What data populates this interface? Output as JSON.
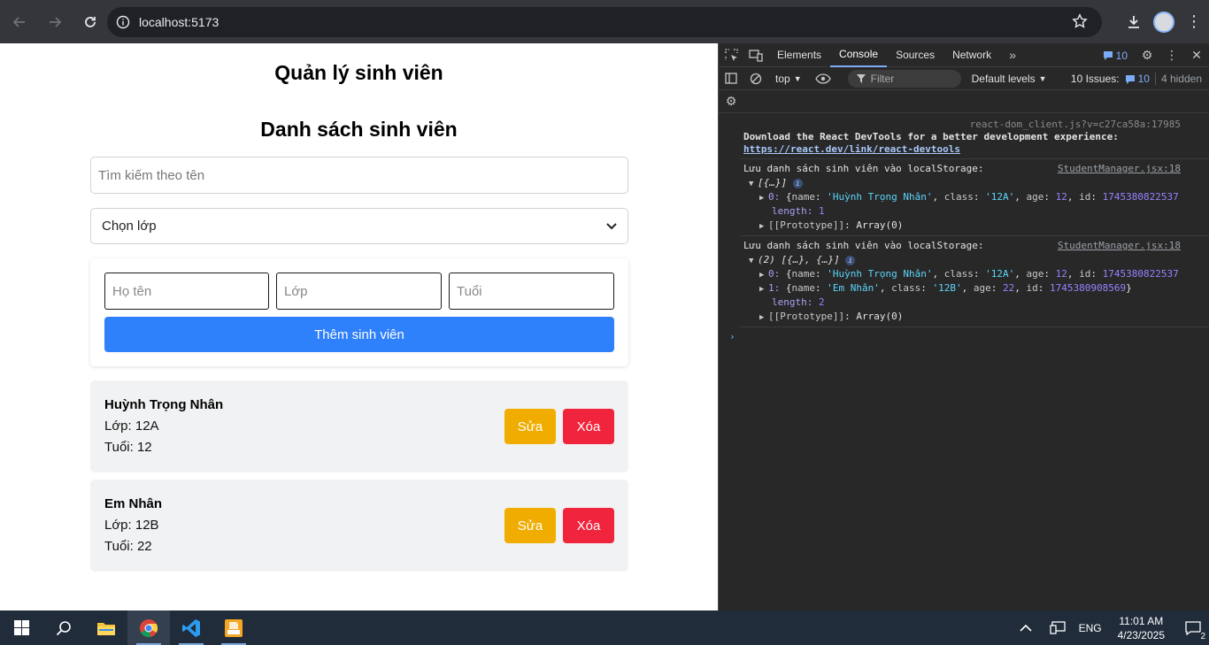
{
  "browser": {
    "url": "localhost:5173"
  },
  "page": {
    "title": "Quản lý sinh viên",
    "list_title": "Danh sách sinh viên",
    "search_placeholder": "Tìm kiếm theo tên",
    "class_select_value": "Chọn lớp",
    "form": {
      "name_placeholder": "Họ tên",
      "class_placeholder": "Lớp",
      "age_placeholder": "Tuổi",
      "add_label": "Thêm sinh viên"
    },
    "students": [
      {
        "name": "Huỳnh Trọng Nhân",
        "class_line": "Lớp: 12A",
        "age_line": "Tuổi: 12",
        "edit_label": "Sửa",
        "delete_label": "Xóa"
      },
      {
        "name": "Em Nhân",
        "class_line": "Lớp: 12B",
        "age_line": "Tuổi: 22",
        "edit_label": "Sửa",
        "delete_label": "Xóa"
      }
    ]
  },
  "devtools": {
    "tabs": [
      "Elements",
      "Console",
      "Sources",
      "Network"
    ],
    "active_tab": "Console",
    "message_count": "10",
    "context": "top",
    "filter_placeholder": "Filter",
    "levels": "Default levels",
    "issues_label": "10 Issues:",
    "issues_count": "10",
    "hidden": "4 hidden",
    "console": {
      "react_source": "react-dom_client.js?v=c27ca58a:17985",
      "react_msg": "Download the React DevTools for a better development experience:",
      "react_link": "https://react.dev/link/react-devtools",
      "log1_msg": "Lưu danh sách sinh viên vào localStorage:",
      "log1_src": "StudentManager.jsx:18",
      "log1_summary": "[{…}]",
      "log1_item0_key": "0:",
      "log1_item0_name": "'Huỳnh Trọng Nhân'",
      "log1_item0_class": "'12A'",
      "log1_item0_age": "12",
      "log1_item0_id": "1745380822537",
      "log1_length": "1",
      "log2_msg": "Lưu danh sách sinh viên vào localStorage:",
      "log2_src": "StudentManager.jsx:18",
      "log2_summary": "(2) [{…}, {…}]",
      "log2_item0_key": "0:",
      "log2_item0_name": "'Huỳnh Trọng Nhân'",
      "log2_item0_class": "'12A'",
      "log2_item0_age": "12",
      "log2_item0_id": "1745380822537",
      "log2_item1_key": "1:",
      "log2_item1_name": "'Em Nhân'",
      "log2_item1_class": "'12B'",
      "log2_item1_age": "22",
      "log2_item1_id": "1745380908569",
      "log2_length": "2",
      "proto": "[[Prototype]]",
      "proto_val": "Array(0)",
      "length_key": "length:"
    }
  },
  "taskbar": {
    "language": "ENG",
    "time": "11:01 AM",
    "date": "4/23/2025",
    "notification_count": "2"
  },
  "colors": {
    "primary": "#2f80fb",
    "warning": "#f0ad00",
    "danger": "#f0243c"
  }
}
